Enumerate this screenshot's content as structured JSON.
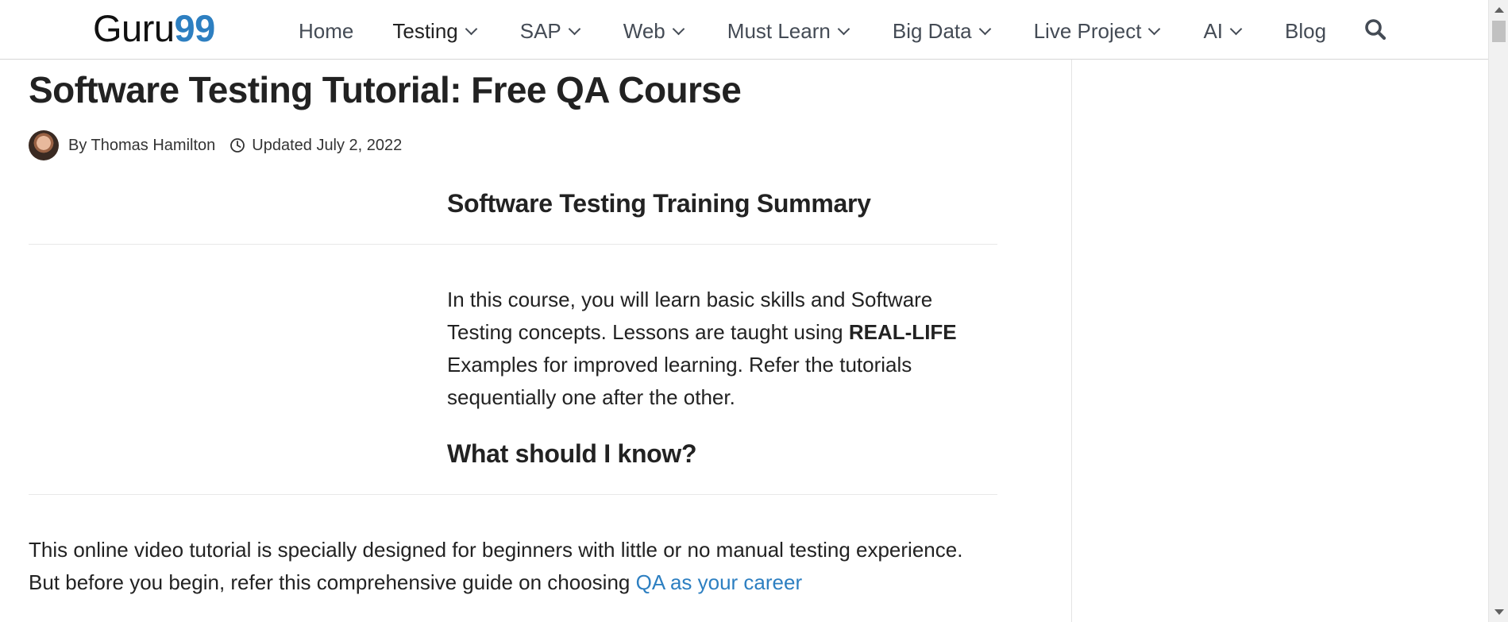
{
  "header": {
    "logo_text": "Guru",
    "logo_number": "99",
    "nav": [
      {
        "label": "Home",
        "has_dropdown": false
      },
      {
        "label": "Testing",
        "has_dropdown": true,
        "active": true
      },
      {
        "label": "SAP",
        "has_dropdown": true
      },
      {
        "label": "Web",
        "has_dropdown": true
      },
      {
        "label": "Must Learn",
        "has_dropdown": true
      },
      {
        "label": "Big Data",
        "has_dropdown": true
      },
      {
        "label": "Live Project",
        "has_dropdown": true
      },
      {
        "label": "AI",
        "has_dropdown": true
      },
      {
        "label": "Blog",
        "has_dropdown": false
      }
    ],
    "search_icon": "search-icon"
  },
  "article": {
    "title": "Software Testing Tutorial: Free QA Course",
    "author": "By Thomas Hamilton",
    "updated": "Updated July 2, 2022",
    "summary_heading": "Software Testing Training Summary",
    "summary_before": "In this course, you will learn basic skills and Software Testing concepts. Lessons are taught using ",
    "summary_bold": "REAL-LIFE",
    "summary_after": " Examples for improved learning. Refer the tutorials sequentially one after the other.",
    "know_heading": "What should I know?",
    "know_text": "This online video tutorial is specially designed for beginners with little or no manual testing experience. But before you begin, refer this comprehensive guide on choosing ",
    "know_link": "QA as your career"
  },
  "colors": {
    "accent": "#2d7fc1",
    "text": "#222222",
    "nav_text": "#444b55",
    "divider": "#e8e8e8"
  }
}
